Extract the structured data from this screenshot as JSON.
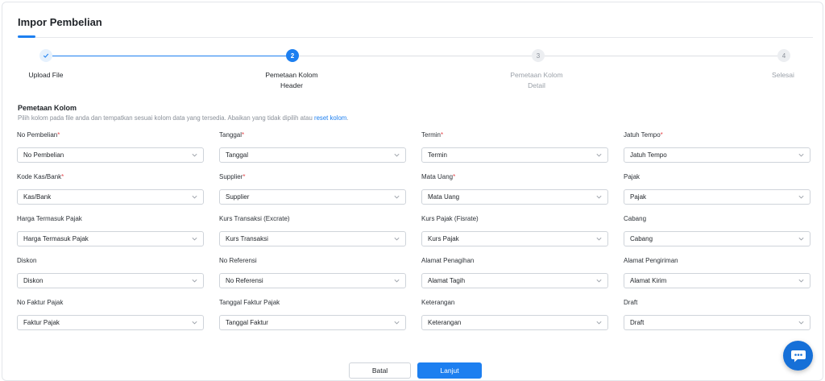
{
  "page": {
    "title": "Impor Pembelian"
  },
  "stepper": {
    "steps": [
      {
        "number": "✓",
        "label": "Upload File",
        "status": "done"
      },
      {
        "number": "2",
        "label": "Pemetaan Kolom Header",
        "status": "active"
      },
      {
        "number": "3",
        "label": "Pemetaan Kolom Detail",
        "status": "todo"
      },
      {
        "number": "4",
        "label": "Selesai",
        "status": "todo"
      }
    ]
  },
  "section": {
    "title": "Pemetaan Kolom",
    "description": "Pilih kolom pada file anda dan tempatkan sesuai kolom data yang tersedia. Abaikan yang tidak dipilih atau",
    "reset_link": "reset kolom",
    "description_end": "."
  },
  "fields": [
    {
      "label": "No Pembelian",
      "required": true,
      "value": "No Pembelian"
    },
    {
      "label": "Tanggal",
      "required": true,
      "value": "Tanggal"
    },
    {
      "label": "Termin",
      "required": true,
      "value": "Termin"
    },
    {
      "label": "Jatuh Tempo",
      "required": true,
      "value": "Jatuh Tempo"
    },
    {
      "label": "Kode Kas/Bank",
      "required": true,
      "value": "Kas/Bank"
    },
    {
      "label": "Supplier",
      "required": true,
      "value": "Supplier"
    },
    {
      "label": "Mata Uang",
      "required": true,
      "value": "Mata Uang"
    },
    {
      "label": "Pajak",
      "required": false,
      "value": "Pajak"
    },
    {
      "label": "Harga Termasuk Pajak",
      "required": false,
      "value": "Harga Termasuk Pajak"
    },
    {
      "label": "Kurs Transaksi (Excrate)",
      "required": false,
      "value": "Kurs Transaksi"
    },
    {
      "label": "Kurs Pajak (Fisrate)",
      "required": false,
      "value": "Kurs Pajak"
    },
    {
      "label": "Cabang",
      "required": false,
      "value": "Cabang"
    },
    {
      "label": "Diskon",
      "required": false,
      "value": "Diskon"
    },
    {
      "label": "No Referensi",
      "required": false,
      "value": "No Referensi"
    },
    {
      "label": "Alamat Penagihan",
      "required": false,
      "value": "Alamat Tagih"
    },
    {
      "label": "Alamat Pengiriman",
      "required": false,
      "value": "Alamat Kirim"
    },
    {
      "label": "No Faktur Pajak",
      "required": false,
      "value": "Faktur Pajak"
    },
    {
      "label": "Tanggal Faktur Pajak",
      "required": false,
      "value": "Tanggal Faktur"
    },
    {
      "label": "Keterangan",
      "required": false,
      "value": "Keterangan"
    },
    {
      "label": "Draft",
      "required": false,
      "value": "Draft"
    }
  ],
  "required_marker": "*",
  "actions": {
    "cancel_label": "Batal",
    "next_label": "Lanjut"
  },
  "icons": {
    "field_dropdown": "chevron-down-icon",
    "chat": "chat-icon",
    "step_done": "check-icon"
  },
  "colors": {
    "accent": "#1d7ff0",
    "required": "#e5484d",
    "muted": "#8a9099"
  }
}
